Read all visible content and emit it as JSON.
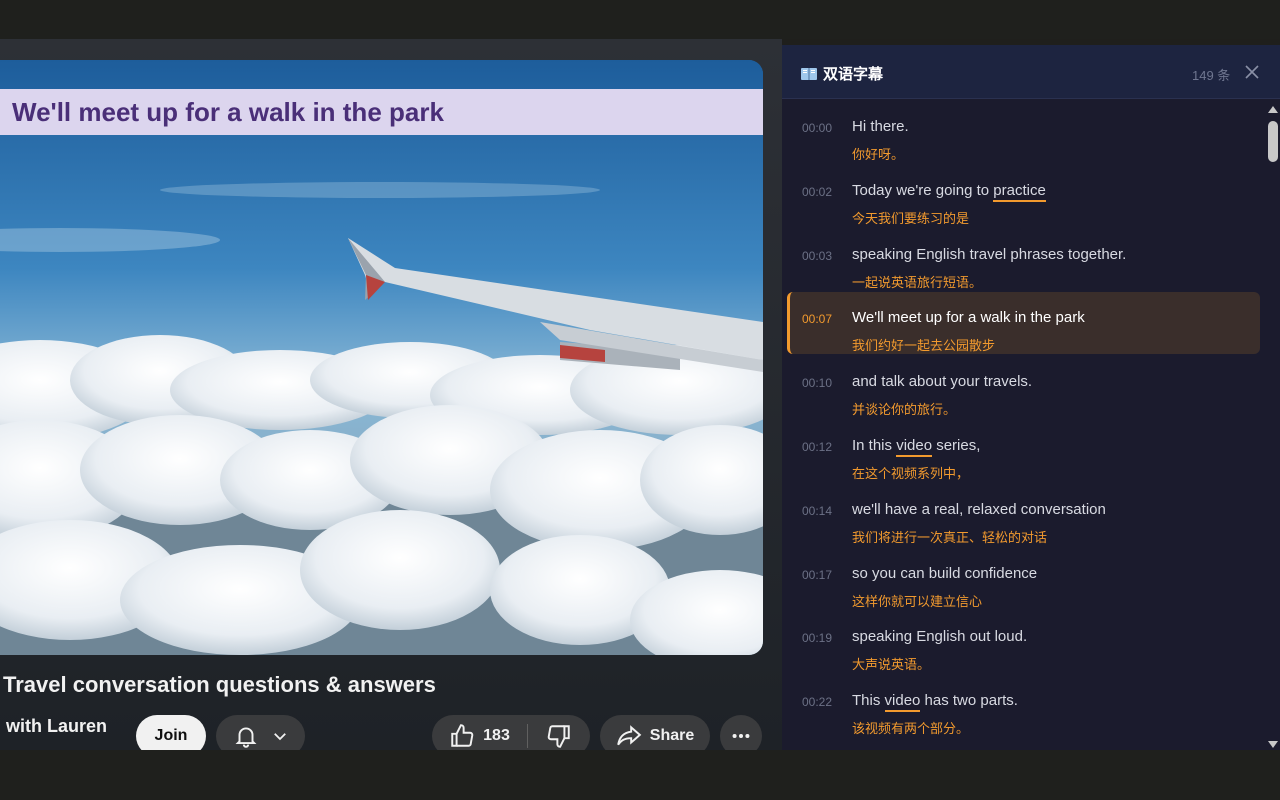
{
  "video": {
    "subtitle_overlay": "We'll meet up for a walk in the park",
    "title": "Travel conversation questions & answers",
    "channel": "n with Lauren",
    "join_label": "Join",
    "like_count": "183",
    "share_label": "Share"
  },
  "panel": {
    "title": "双语字幕",
    "count": "149 条",
    "items": [
      {
        "time": "00:00",
        "en": "Hi there.",
        "zh": "你好呀。"
      },
      {
        "time": "00:02",
        "en_pre": "Today we're going to ",
        "en_hl": "practice",
        "en_post": "",
        "zh": "今天我们要练习的是"
      },
      {
        "time": "00:03",
        "en": "speaking English travel phrases together.",
        "zh": "一起说英语旅行短语。"
      },
      {
        "time": "00:07",
        "en": "We'll meet up for a walk in the park",
        "zh": "我们约好一起去公园散步",
        "active": true
      },
      {
        "time": "00:10",
        "en": "and talk about your travels.",
        "zh": "并谈论你的旅行。"
      },
      {
        "time": "00:12",
        "en_pre": "In this ",
        "en_hl": "video",
        "en_post": " series,",
        "zh": "在这个视频系列中，"
      },
      {
        "time": "00:14",
        "en": "we'll have a real, relaxed conversation",
        "zh": "我们将进行一次真正、轻松的对话"
      },
      {
        "time": "00:17",
        "en": "so you can build confidence",
        "zh": "这样你就可以建立信心"
      },
      {
        "time": "00:19",
        "en": "speaking English out loud.",
        "zh": "大声说英语。"
      },
      {
        "time": "00:22",
        "en_pre": "This ",
        "en_hl": "video",
        "en_post": " has two parts.",
        "zh": "该视频有两个部分。"
      }
    ]
  },
  "colors": {
    "accent": "#f29a2e",
    "panel_bg": "#1b1b2d",
    "overlay_text": "#4a2f78"
  }
}
